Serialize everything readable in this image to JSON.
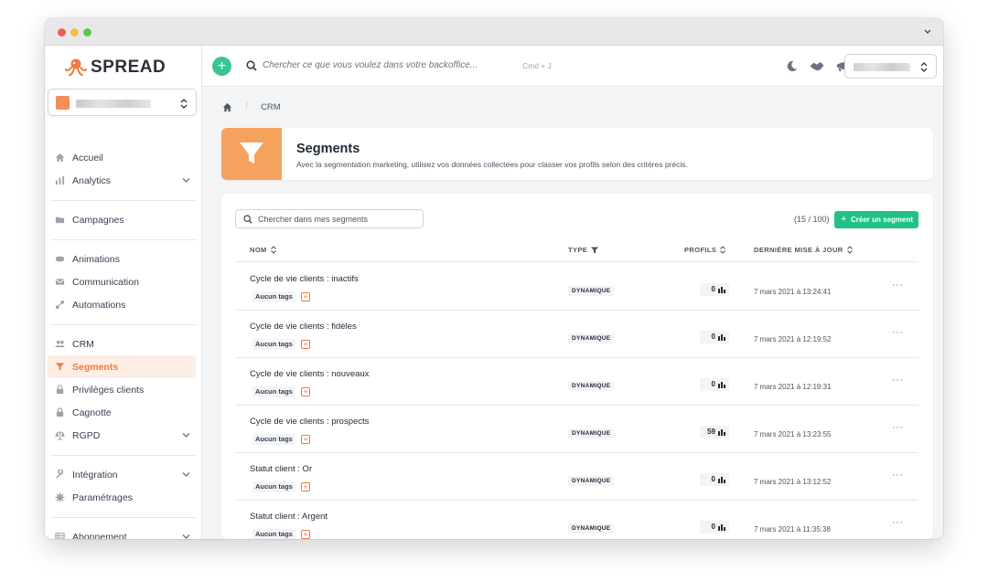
{
  "brand": {
    "name": "SPREAD",
    "accent": "#f07a3c",
    "green": "#22c284"
  },
  "topbar": {
    "search_placeholder": "Chercher ce que vous voulez dans votre backoffice...",
    "shortcut": "Cmd + J",
    "icons": [
      "moon-icon",
      "handshake-icon",
      "megaphone-icon",
      "bell-icon"
    ]
  },
  "sidebar": {
    "groups": [
      [
        {
          "label": "Accueil",
          "icon": "home-icon"
        },
        {
          "label": "Analytics",
          "icon": "chart-icon",
          "chevron": true
        }
      ],
      [
        {
          "label": "Campagnes",
          "icon": "folder-icon"
        }
      ],
      [
        {
          "label": "Animations",
          "icon": "gamepad-icon"
        },
        {
          "label": "Communication",
          "icon": "envelope-icon"
        },
        {
          "label": "Automations",
          "icon": "flow-icon"
        }
      ],
      [
        {
          "label": "CRM",
          "icon": "users-icon"
        },
        {
          "label": "Segments",
          "icon": "filter-icon",
          "active": true
        },
        {
          "label": "Privilèges clients",
          "icon": "lock-icon"
        },
        {
          "label": "Cagnotte",
          "icon": "lock-icon"
        },
        {
          "label": "RGPD",
          "icon": "scale-icon",
          "chevron": true
        }
      ],
      [
        {
          "label": "Intégration",
          "icon": "wrench-icon",
          "chevron": true
        },
        {
          "label": "Paramétrages",
          "icon": "gear-icon"
        }
      ],
      [
        {
          "label": "Abonnement",
          "icon": "table-icon",
          "chevron": true
        }
      ]
    ]
  },
  "breadcrumb": {
    "current": "CRM"
  },
  "header": {
    "title": "Segments",
    "subtitle": "Avec la segmentation marketing, utilisez vos données collectées pour classer vos profils selon des critères précis."
  },
  "segments": {
    "search_placeholder": "Chercher dans mes segments",
    "count": "(15 / 100)",
    "create_label": "Créer un segment",
    "columns": {
      "name": "NOM",
      "type": "TYPE",
      "profiles": "PROFILS",
      "updated": "DERNIÈRE MISE À JOUR"
    },
    "rows": [
      {
        "name": "Cycle de vie clients : inactifs",
        "tag": "Aucun tags",
        "type": "DYNAMIQUE",
        "profiles": "0",
        "updated": "7 mars 2021 à 13:24:41"
      },
      {
        "name": "Cycle de vie clients : fidèles",
        "tag": "Aucun tags",
        "type": "DYNAMIQUE",
        "profiles": "0",
        "updated": "7 mars 2021 à 12:19:52"
      },
      {
        "name": "Cycle de vie clients : nouveaux",
        "tag": "Aucun tags",
        "type": "DYNAMIQUE",
        "profiles": "0",
        "updated": "7 mars 2021 à 12:19:31"
      },
      {
        "name": "Cycle de vie clients : prospects",
        "tag": "Aucun tags",
        "type": "DYNAMIQUE",
        "profiles": "59",
        "updated": "7 mars 2021 à 13:23:55"
      },
      {
        "name": "Statut client : Or",
        "tag": "Aucun tags",
        "type": "DYNAMIQUE",
        "profiles": "0",
        "updated": "7 mars 2021 à 13:12:52"
      },
      {
        "name": "Statut client : Argent",
        "tag": "Aucun tags",
        "type": "DYNAMIQUE",
        "profiles": "0",
        "updated": "7 mars 2021 à 11:35:38"
      }
    ]
  }
}
